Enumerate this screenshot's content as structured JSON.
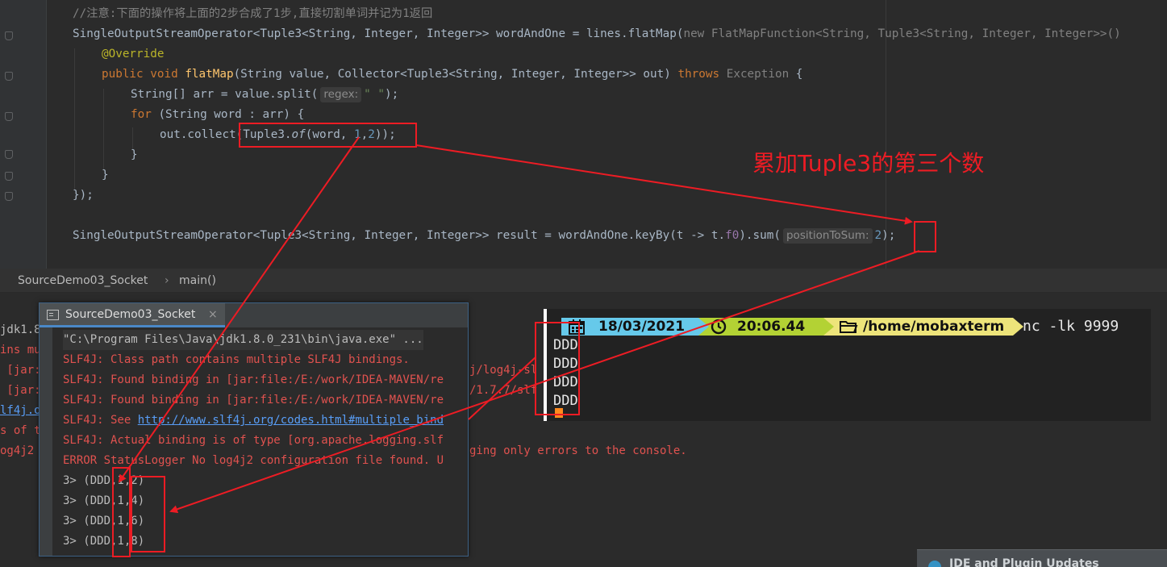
{
  "editor": {
    "comment": "//注意:下面的操作将上面的2步合成了1步,直接切割单词并记为1返回",
    "line1": {
      "decl": "SingleOutputStreamOperator<Tuple3<String, Integer, Integer>> wordAndOne = lines.flatMap(",
      "new_kw": "new ",
      "anon": "FlatMapFunction<String, Tuple3<String, Integer, Integer>>()"
    },
    "override": "@Override",
    "line3": {
      "kw1": "public ",
      "kw2": "void ",
      "method": "flatMap",
      "params": "(String value, Collector<Tuple3<String, Integer, Integer>> out) ",
      "throws_kw": "throws ",
      "exception": "Exception",
      "brace": " {"
    },
    "line4": {
      "pre": "String[] arr = value.split(",
      "hint": "regex:",
      "str": "\" \"",
      "post": ");"
    },
    "line5": {
      "kw": "for ",
      "rest": "(String word : arr) {"
    },
    "line6": {
      "pre": "out.collect(Tuple3.",
      "of": "of",
      "args_open": "(word, ",
      "n1": "1",
      "comma": ",",
      "n2": "2",
      "close": "));"
    },
    "brace_inner": "}",
    "brace_method": "}",
    "brace_close": "});",
    "line_result": {
      "pre": "SingleOutputStreamOperator<Tuple3<String, Integer, Integer>> result = wordAndOne.keyBy(t -> t.",
      "field": "f0",
      "mid": ").sum(",
      "hint": "positionToSum:",
      "num": "2",
      "end": ");"
    }
  },
  "breadcrumb": {
    "class_name": "SourceDemo03_Socket",
    "separator": "›",
    "method": "main()"
  },
  "background_console": [
    {
      "text": "jdk1.8",
      "color": "gray"
    },
    {
      "text": "ins mu",
      "color": "red"
    },
    {
      "text": " [jar:",
      "color": "red",
      "tail": "j/log4j-sl"
    },
    {
      "text": " [jar:",
      "color": "red",
      "tail": "/1.7.7/slf"
    },
    {
      "text": "lf4j.o",
      "color": "link"
    },
    {
      "text": "s of t",
      "color": "red"
    },
    {
      "text": "og4j2 ",
      "color": "red",
      "tail": "ging only errors to the console."
    }
  ],
  "run_window": {
    "tab_label": "SourceDemo03_Socket",
    "tab_close": "×",
    "lines": [
      {
        "text": "\"C:\\Program Files\\Java\\jdk1.8.0_231\\bin\\java.exe\" ...",
        "style": "gray-out"
      },
      {
        "text": "SLF4J: Class path contains multiple SLF4J bindings.",
        "style": "red"
      },
      {
        "text": "SLF4J: Found binding in [jar:file:/E:/work/IDEA-MAVEN/re",
        "style": "red"
      },
      {
        "text": "SLF4J: Found binding in [jar:file:/E:/work/IDEA-MAVEN/re",
        "style": "red"
      },
      {
        "prefix": "SLF4J: See ",
        "link": "http://www.slf4j.org/codes.html#multiple_bind",
        "style": "red"
      },
      {
        "text": "SLF4J: Actual binding is of type [org.apache.logging.slf",
        "style": "red"
      },
      {
        "text": "ERROR StatusLogger No log4j2 configuration file found. U",
        "style": "red"
      },
      {
        "text": "3> (DDD,1,2)",
        "style": "plain"
      },
      {
        "text": "3> (DDD,1,4)",
        "style": "plain"
      },
      {
        "text": "3> (DDD,1,6)",
        "style": "plain"
      },
      {
        "text": "3> (DDD,1,8)",
        "style": "plain"
      }
    ]
  },
  "terminal": {
    "date": "18/03/2021",
    "time": "20:06.44",
    "path": "/home/mobaxterm",
    "command": "nc -lk 9999",
    "lines": [
      "DDD",
      "DDD",
      "DDD",
      "DDD"
    ],
    "colors": {
      "date_bg": "#66c9ea",
      "time_bg": "#b3d234",
      "path_bg": "#ede47a",
      "cursor": "#ff8a1e"
    }
  },
  "annotation": {
    "label": "累加Tuple3的第三个数",
    "color": "#ed1c24"
  },
  "notification": {
    "title": "IDE and Plugin Updates"
  }
}
